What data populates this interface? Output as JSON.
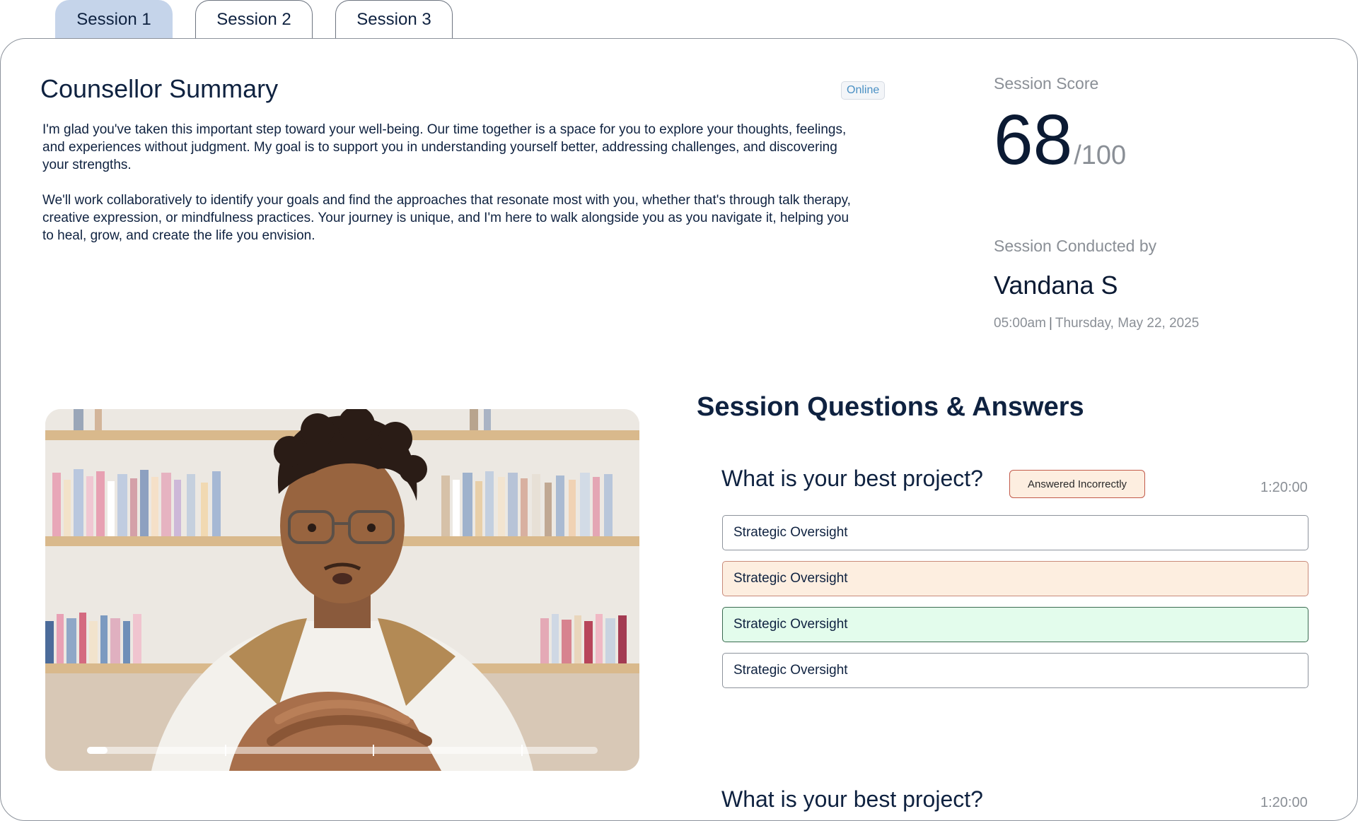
{
  "tabs": [
    {
      "label": "Session 1",
      "active": true
    },
    {
      "label": "Session 2",
      "active": false
    },
    {
      "label": "Session 3",
      "active": false
    }
  ],
  "summary": {
    "title": "Counsellor Summary",
    "mode_badge": "Online",
    "paragraphs": [
      "I'm glad you've taken this important step toward your well-being. Our time together is a space for you to explore your thoughts, feelings, and experiences without judgment. My goal is to support you in understanding yourself better, addressing challenges, and discovering your strengths.",
      "We'll work collaboratively to identify your goals and find the approaches that resonate most with you, whether that's through talk therapy, creative expression, or mindfulness practices. Your journey is unique, and I'm here to walk alongside you as you navigate it, helping you to heal, grow, and create the life you envision."
    ]
  },
  "score": {
    "label": "Session Score",
    "value": "68",
    "max": "/100"
  },
  "conducted": {
    "label": "Session Conducted by",
    "name": "Vandana S",
    "time": "05:00am",
    "separator": "|",
    "date": "Thursday, May 22, 2025"
  },
  "video": {
    "progress": 0.04,
    "chapter_marks": [
      0.27,
      0.56,
      0.85
    ]
  },
  "qa": {
    "title": "Session Questions & Answers",
    "questions": [
      {
        "text": "What is your best project?",
        "status": "Answered Incorrectly",
        "time": "1:20:00",
        "options": [
          {
            "text": "Strategic Oversight",
            "state": "neutral"
          },
          {
            "text": "Strategic Oversight",
            "state": "incorrect"
          },
          {
            "text": "Strategic Oversight",
            "state": "correct"
          },
          {
            "text": "Strategic Oversight",
            "state": "neutral"
          }
        ]
      },
      {
        "text": "What is your best project?",
        "time": "1:20:00"
      }
    ]
  },
  "colors": {
    "active_tab": "#c5d4ea",
    "incorrect_fill": "#fdeee0",
    "correct_fill": "#e3fcec",
    "text_primary": "#0f2240",
    "text_muted": "#8a8f96"
  }
}
